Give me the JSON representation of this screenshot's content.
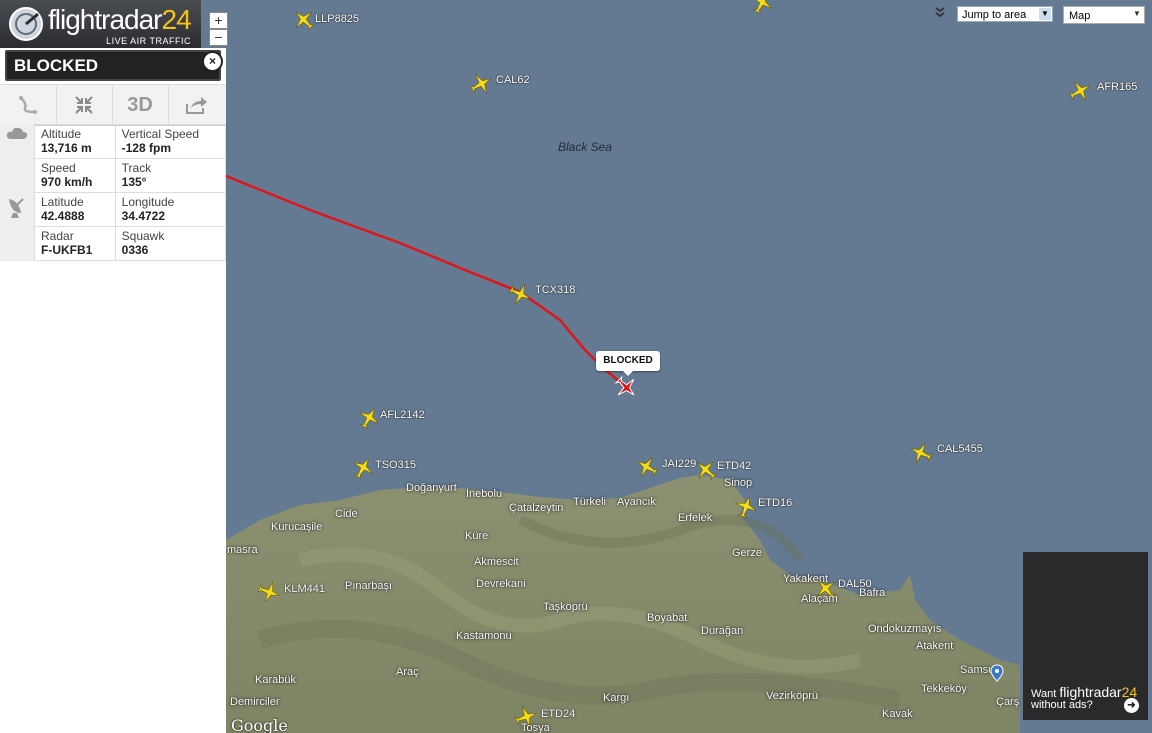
{
  "header": {
    "brand_main": "flightradar",
    "brand_num": "24",
    "tagline": "LIVE AIR TRAFFIC"
  },
  "zoom": {
    "in": "+",
    "out": "−"
  },
  "panel": {
    "status": "BLOCKED",
    "close": "×",
    "tools": {
      "route_icon": "route-icon",
      "fit_icon": "fit-icon",
      "threed": "3D",
      "share_icon": "share-icon"
    },
    "fields": [
      {
        "label": "Altitude",
        "value": "13,716 m"
      },
      {
        "label": "Vertical Speed",
        "value": "-128 fpm"
      },
      {
        "label": "Speed",
        "value": "970 km/h"
      },
      {
        "label": "Track",
        "value": "135°"
      },
      {
        "label": "Latitude",
        "value": "42.4888"
      },
      {
        "label": "Longitude",
        "value": "34.4722"
      },
      {
        "label": "Radar",
        "value": "F-UKFB1"
      },
      {
        "label": "Squawk",
        "value": "0336"
      }
    ]
  },
  "controls": {
    "jump_to": "Jump to area",
    "map_type": "Map"
  },
  "map": {
    "sea_name": "Black Sea",
    "selected_callout": "BLOCKED",
    "flights": [
      "LLP8825",
      "CAL62",
      "AFR165",
      "TCX318",
      "AFL2142",
      "TSO315",
      "JAI229",
      "ETD42",
      "ETD16",
      "CAL5455",
      "KLM441",
      "DAL50",
      "ETD24"
    ],
    "places": [
      "Doğanyurt",
      "İnebolu",
      "Cide",
      "Kurucaşile",
      "Çatalzeytin",
      "Türkeli",
      "Ayancık",
      "Erfelek",
      "Sinop",
      "Küre",
      "Akmescit",
      "Devrekani",
      "Pınarbaşı",
      "Gerze",
      "Yakakent",
      "Bafra",
      "Taşköprü",
      "Boyabat",
      "Kastamonu",
      "Durağan",
      "Ondokuzmayıs",
      "Atakent",
      "Samsun",
      "Karabük",
      "Araç",
      "Kargı",
      "Vezirköprü",
      "Tekkeköy",
      "Demirciler",
      "Kavak",
      "Alaçam",
      "Tosya",
      "Çarş",
      "masra"
    ]
  },
  "ad": {
    "want": "Want ",
    "brand_main": "flightradar",
    "brand_num": "24",
    "without": "without ads?",
    "go": "➜"
  },
  "footer": {
    "google": "Google"
  }
}
